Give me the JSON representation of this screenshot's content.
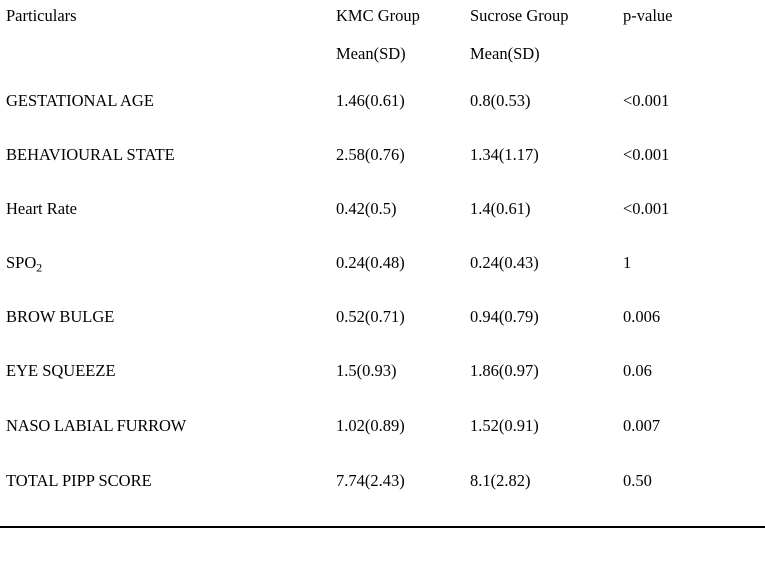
{
  "table": {
    "headers": {
      "particulars": "Particulars",
      "kmc_group": "KMC Group",
      "sucrose_group": "Sucrose Group",
      "p_value": "p-value"
    },
    "subheaders": {
      "kmc_stat": "Mean(SD)",
      "sucrose_stat": "Mean(SD)"
    },
    "rows": [
      {
        "particular": "GESTATIONAL AGE",
        "kmc": "1.46(0.61)",
        "sucrose": "0.8(0.53)",
        "p": "<0.001"
      },
      {
        "particular": "BEHAVIOURAL STATE",
        "kmc": "2.58(0.76)",
        "sucrose": "1.34(1.17)",
        "p": "<0.001"
      },
      {
        "particular": "Heart Rate",
        "kmc": "0.42(0.5)",
        "sucrose": "1.4(0.61)",
        "p": "<0.001"
      },
      {
        "particular_prefix": "SPO",
        "particular_sub": "2",
        "kmc": "0.24(0.48)",
        "sucrose": "0.24(0.43)",
        "p": "1"
      },
      {
        "particular": "BROW BULGE",
        "kmc": "0.52(0.71)",
        "sucrose": "0.94(0.79)",
        "p": "0.006"
      },
      {
        "particular": "EYE SQUEEZE",
        "kmc": "1.5(0.93)",
        "sucrose": "1.86(0.97)",
        "p": "0.06"
      },
      {
        "particular": "NASO LABIAL FURROW",
        "kmc": "1.02(0.89)",
        "sucrose": "1.52(0.91)",
        "p": "0.007"
      },
      {
        "particular": "TOTAL PIPP SCORE",
        "kmc": "7.74(2.43)",
        "sucrose": "8.1(2.82)",
        "p": "0.50"
      }
    ]
  },
  "colors": {
    "border": "#000000",
    "text": "#000000",
    "background": "#ffffff"
  }
}
